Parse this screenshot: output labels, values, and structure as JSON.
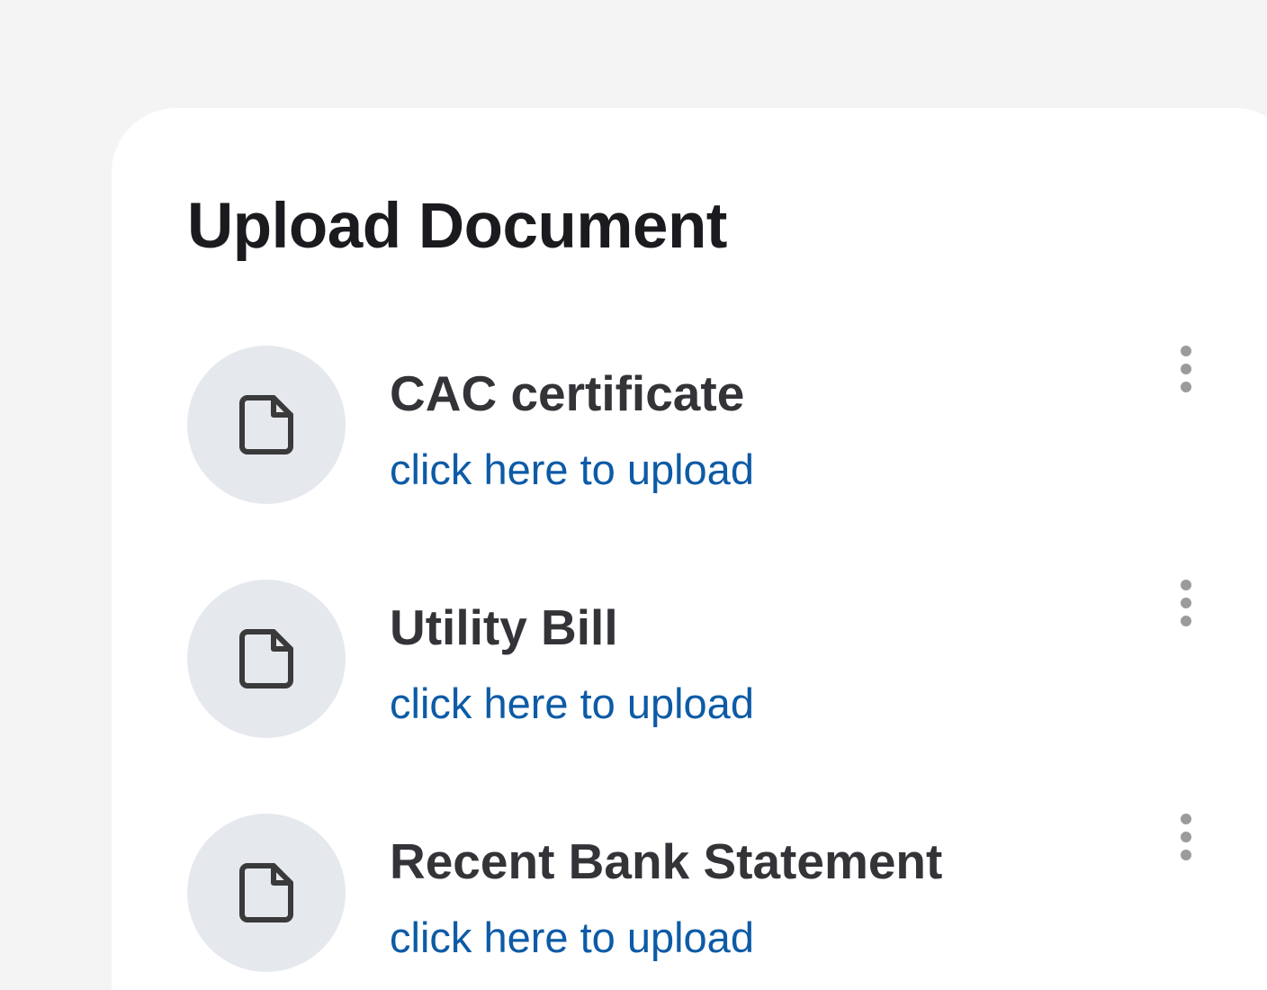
{
  "page": {
    "title": "Upload Document"
  },
  "documents": [
    {
      "name": "CAC certificate",
      "action_label": "click here to upload",
      "icon": "document-icon"
    },
    {
      "name": "Utility Bill",
      "action_label": "click here to upload",
      "icon": "document-icon"
    },
    {
      "name": "Recent Bank Statement",
      "action_label": "click here to upload",
      "icon": "document-icon"
    }
  ],
  "colors": {
    "background": "#f4f4f4",
    "card": "#ffffff",
    "title": "#1b1b1f",
    "doc_name": "#333338",
    "link": "#0d5ba6",
    "icon_circle": "#e5e8ed",
    "icon_stroke": "#3a3a3a",
    "menu_dots": "#9b9b9b"
  }
}
